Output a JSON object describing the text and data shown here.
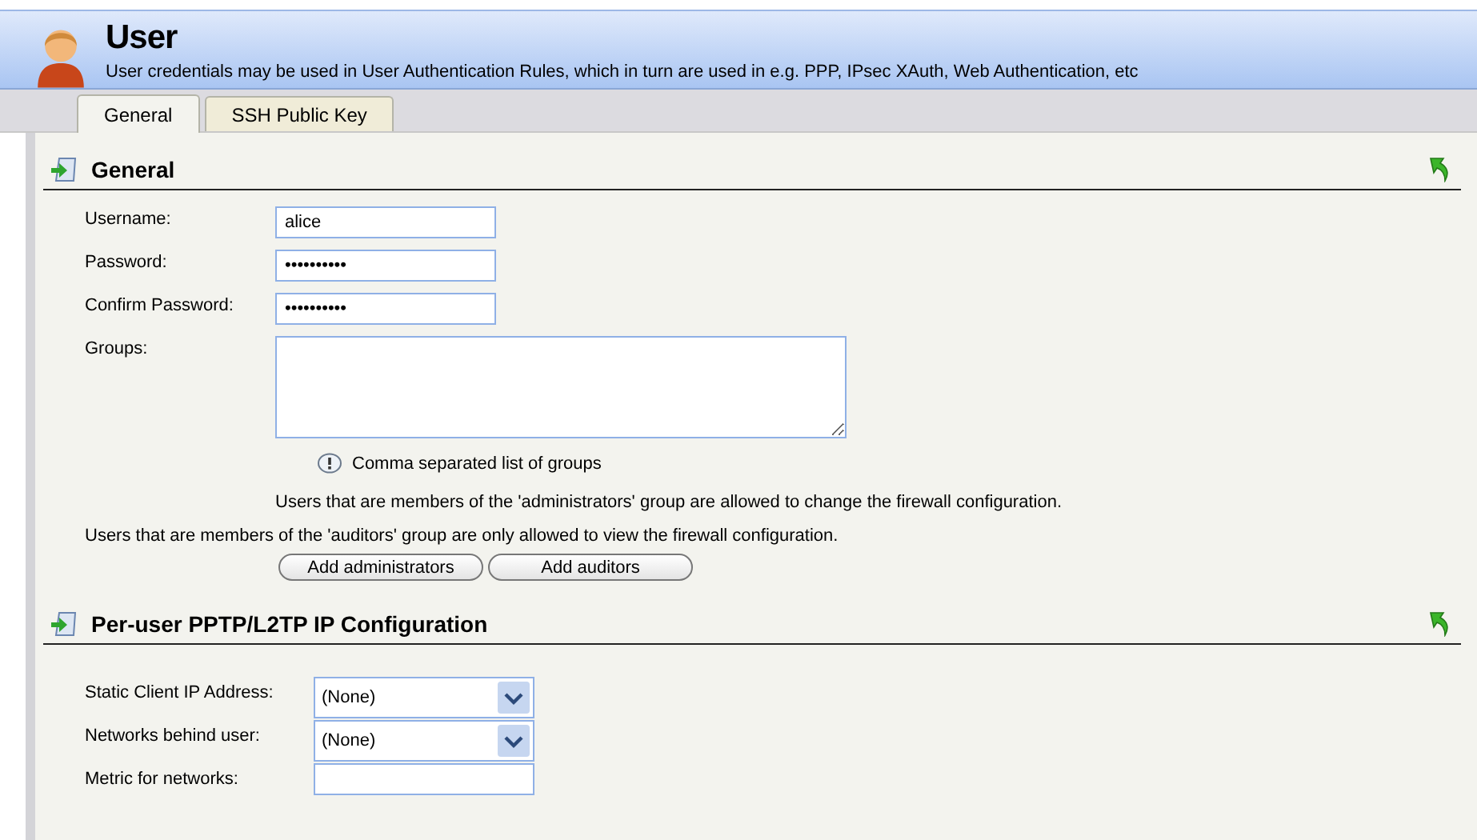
{
  "header": {
    "title": "User",
    "subtitle": "User credentials may be used in User Authentication Rules, which in turn are used in e.g. PPP, IPsec XAuth, Web Authentication, etc"
  },
  "tabs": [
    {
      "label": "General",
      "selected": true
    },
    {
      "label": "SSH Public Key",
      "selected": false
    }
  ],
  "sections": [
    {
      "title": "General",
      "fields": [
        {
          "kind": "text",
          "label": "Username:",
          "value": "alice"
        },
        {
          "kind": "text",
          "label": "Password:",
          "value": "••••••••••"
        },
        {
          "kind": "text",
          "label": "Confirm Password:",
          "value": "••••••••••"
        },
        {
          "kind": "textarea",
          "label": "Groups:"
        }
      ],
      "hint": "Comma separated list of groups",
      "note_indented": "Users that are members of the 'administrators' group are allowed to change the firewall configuration.",
      "note": "Users that are members of the 'auditors' group are only allowed to view the firewall configuration.",
      "buttons": [
        "Add administrators",
        "Add auditors"
      ]
    },
    {
      "title": "Per-user PPTP/L2TP IP Configuration",
      "fields": [
        {
          "kind": "select",
          "label": "Static Client IP Address:",
          "value": "(None)"
        },
        {
          "kind": "select",
          "label": "Networks behind user:",
          "value": "(None)"
        },
        {
          "kind": "text",
          "label": "Metric for networks:"
        }
      ]
    }
  ]
}
